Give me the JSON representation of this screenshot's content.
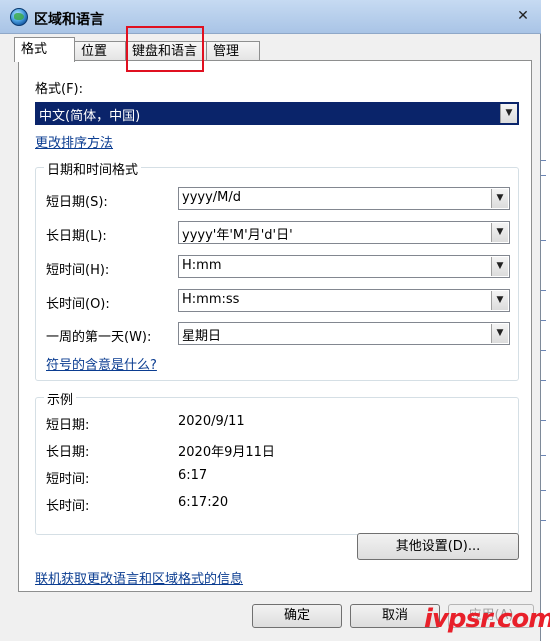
{
  "window": {
    "title": "区域和语言",
    "close_glyph": "✕"
  },
  "tabs": [
    {
      "label": "格式",
      "active": true
    },
    {
      "label": "位置"
    },
    {
      "label": "键盘和语言"
    },
    {
      "label": "管理"
    }
  ],
  "format": {
    "label": "格式(F):",
    "value": "中文(简体，中国)",
    "sort_link": "更改排序方法"
  },
  "datetime": {
    "group_title": "日期和时间格式",
    "rows": [
      {
        "label": "短日期(S):",
        "value": "yyyy/M/d"
      },
      {
        "label": "长日期(L):",
        "value": "yyyy'年'M'月'd'日'"
      },
      {
        "label": "短时间(H):",
        "value": "H:mm"
      },
      {
        "label": "长时间(O):",
        "value": "H:mm:ss"
      },
      {
        "label": "一周的第一天(W):",
        "value": "星期日"
      }
    ],
    "symbol_link": "符号的含意是什么?"
  },
  "examples": {
    "group_title": "示例",
    "rows": [
      {
        "label": "短日期:",
        "value": "2020/9/11"
      },
      {
        "label": "长日期:",
        "value": "2020年9月11日"
      },
      {
        "label": "短时间:",
        "value": "6:17"
      },
      {
        "label": "长时间:",
        "value": "6:17:20"
      }
    ]
  },
  "buttons": {
    "other_settings": "其他设置(D)...",
    "ok": "确定",
    "cancel": "取消",
    "apply": "应用(A)"
  },
  "online_link": "联机获取更改语言和区域格式的信息",
  "watermark": "ivpsr.com",
  "colors": {
    "highlight_box": "#e01020",
    "selection": "#0a246a",
    "link": "#0b3d91",
    "watermark": "#e8202a"
  }
}
